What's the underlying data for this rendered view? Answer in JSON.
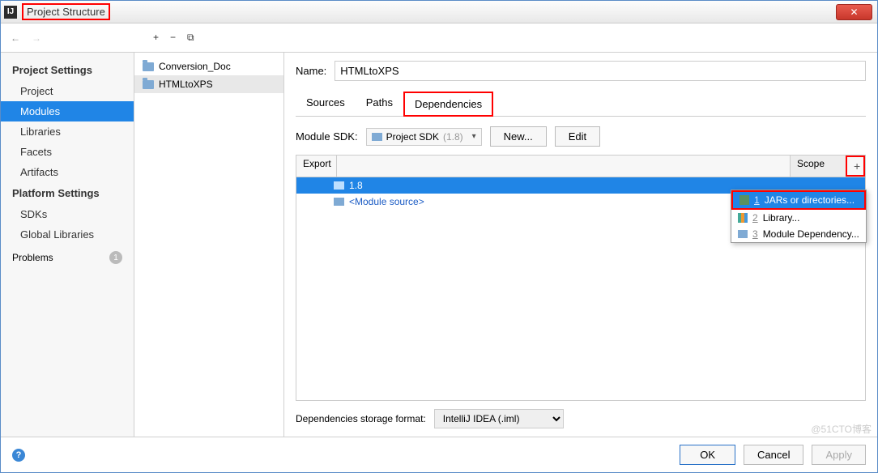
{
  "window": {
    "title": "Project Structure"
  },
  "sidebar": {
    "section1_title": "Project Settings",
    "items1": [
      "Project",
      "Modules",
      "Libraries",
      "Facets",
      "Artifacts"
    ],
    "section2_title": "Platform Settings",
    "items2": [
      "SDKs",
      "Global Libraries"
    ],
    "problems_label": "Problems",
    "problems_count": "1"
  },
  "modules": {
    "list": [
      "Conversion_Doc",
      "HTMLtoXPS"
    ]
  },
  "main": {
    "name_label": "Name:",
    "name_value": "HTMLtoXPS",
    "tabs": [
      "Sources",
      "Paths",
      "Dependencies"
    ],
    "sdk_label": "Module SDK:",
    "sdk_value": "Project SDK",
    "sdk_version": "(1.8)",
    "new_btn": "New...",
    "edit_btn": "Edit",
    "table": {
      "col_export": "Export",
      "col_scope": "Scope",
      "add_btn": "+",
      "rows": [
        {
          "label": "1.8",
          "selected": true
        },
        {
          "label": "<Module source>",
          "link": true
        }
      ]
    },
    "popup": [
      {
        "num": "1",
        "label": "JARs or directories...",
        "selected": true
      },
      {
        "num": "2",
        "label": "Library..."
      },
      {
        "num": "3",
        "label": "Module Dependency..."
      }
    ],
    "storage_label": "Dependencies storage format:",
    "storage_value": "IntelliJ IDEA (.iml)"
  },
  "footer": {
    "ok": "OK",
    "cancel": "Cancel",
    "apply": "Apply"
  },
  "watermark": "@51CTO博客"
}
